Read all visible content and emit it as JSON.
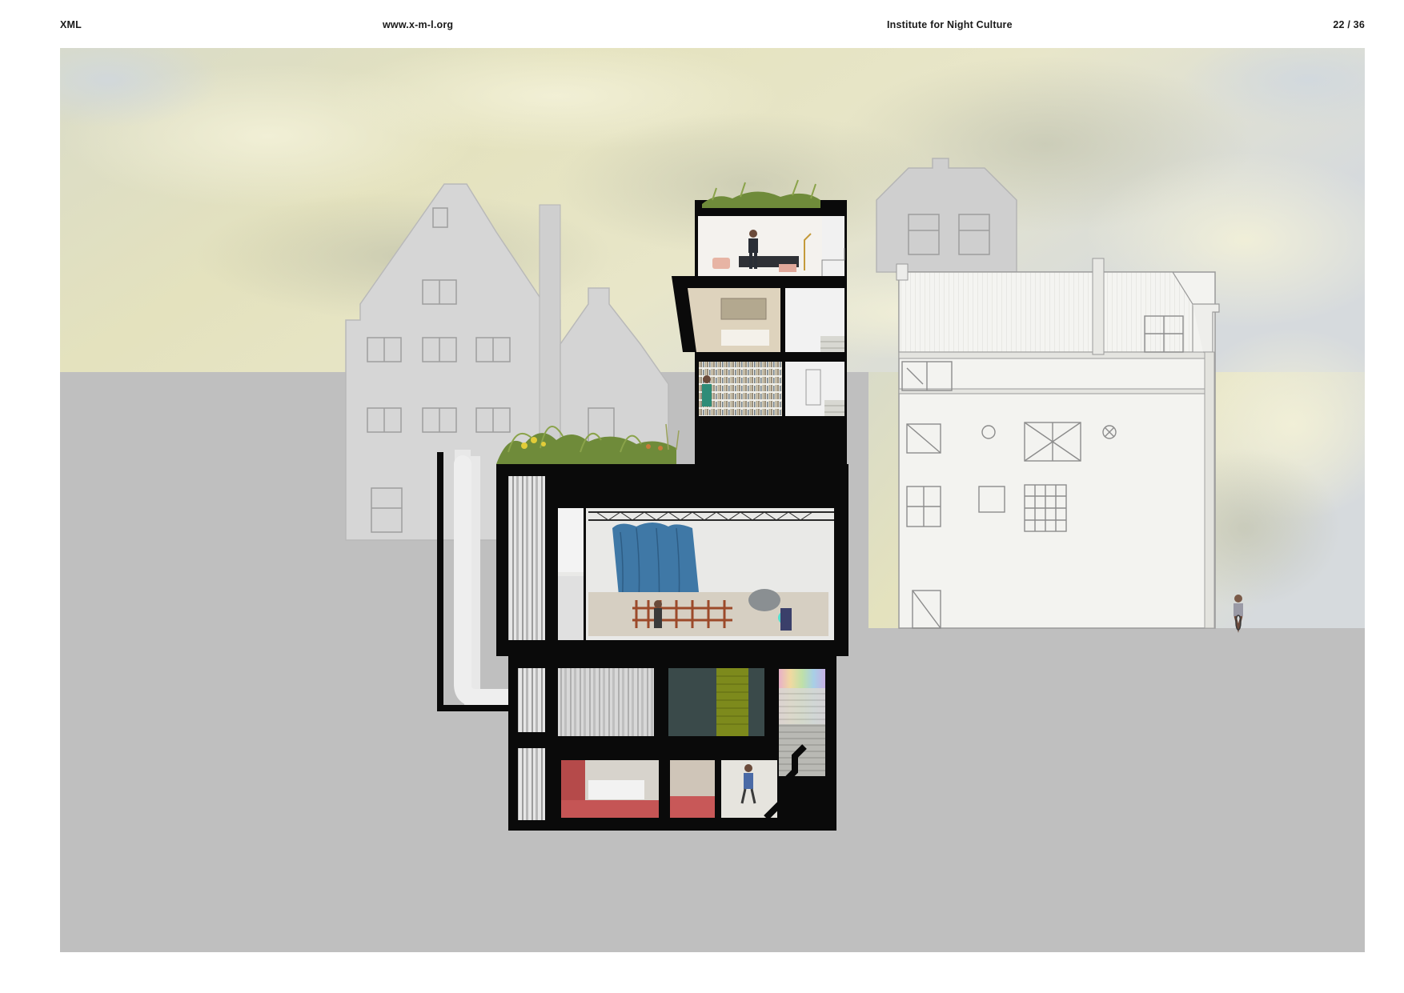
{
  "header": {
    "brand": "XML",
    "url": "www.x-m-l.org",
    "title": "Institute for Night Culture",
    "page_indicator": "22 / 36"
  },
  "figure": {
    "kind": "architectural section drawing",
    "palette": {
      "sky": "#dcdcc4",
      "ground": "#bfbfbf",
      "section_cut": "#0a0a0a",
      "neighbour_buildings": "#d6d6d6",
      "right_elevation": "#f3f3f0",
      "green_roof": "#6f8b3a",
      "curtain_blue": "#3f78a6",
      "floor_red": "#b54a4a",
      "wall_green": "#7d8a1c"
    },
    "icons": [
      "person-figure-icon",
      "cyclist-icon",
      "stair-icon",
      "window-icon"
    ]
  }
}
